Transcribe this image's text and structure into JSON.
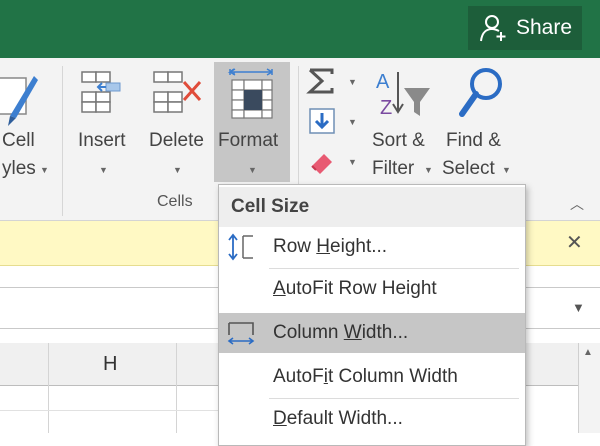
{
  "titlebar": {
    "share_label": "Share",
    "bg": "#217346"
  },
  "ribbon": {
    "cells_group": {
      "label": "Cells",
      "partial_prev": {
        "line1": "Cell",
        "line2": "yles"
      },
      "insert": {
        "label": "Insert"
      },
      "delete": {
        "label": "Delete"
      },
      "format": {
        "label": "Format"
      }
    },
    "editing_group": {
      "sort_filter": {
        "line1": "Sort &",
        "line2": "Filter"
      },
      "find_select": {
        "line1": "Find &",
        "line2": "Select"
      }
    }
  },
  "grid": {
    "columns": [
      "H"
    ]
  },
  "format_menu": {
    "section_header": "Cell Size",
    "items": [
      {
        "pre": "Row ",
        "u": "H",
        "post": "eight..."
      },
      {
        "pre": "",
        "u": "A",
        "post": "utoFit Row Height"
      },
      {
        "pre": "Column ",
        "u": "W",
        "post": "idth..."
      },
      {
        "pre": "AutoF",
        "u": "i",
        "post": "t Column Width"
      },
      {
        "pre": "",
        "u": "D",
        "post": "efault Width..."
      }
    ]
  }
}
